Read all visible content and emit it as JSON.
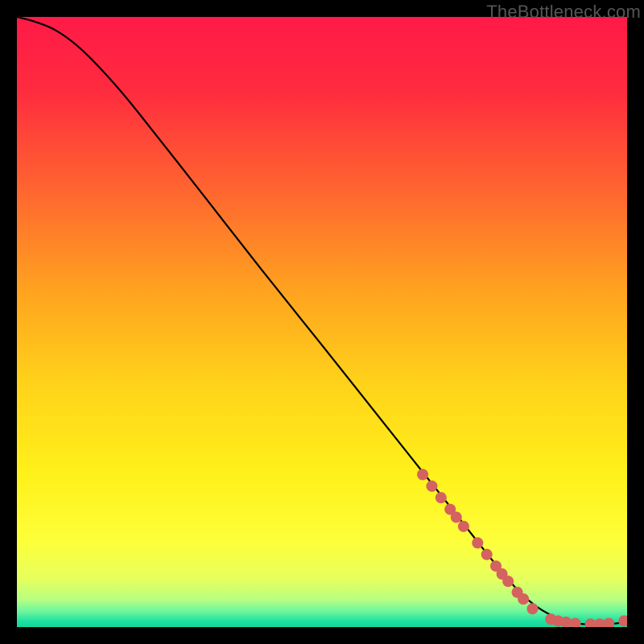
{
  "watermark": "TheBottleneck.com",
  "chart_data": {
    "type": "line",
    "title": "",
    "xlabel": "",
    "ylabel": "",
    "xlim": [
      0,
      100
    ],
    "ylim": [
      0,
      100
    ],
    "background_gradient": {
      "stops": [
        {
          "offset": 0.0,
          "color": "#ff1a47"
        },
        {
          "offset": 0.12,
          "color": "#ff2b3f"
        },
        {
          "offset": 0.3,
          "color": "#ff6b2e"
        },
        {
          "offset": 0.45,
          "color": "#ffa31f"
        },
        {
          "offset": 0.6,
          "color": "#ffd21a"
        },
        {
          "offset": 0.75,
          "color": "#fff11a"
        },
        {
          "offset": 0.86,
          "color": "#fdff3a"
        },
        {
          "offset": 0.92,
          "color": "#e7ff5c"
        },
        {
          "offset": 0.955,
          "color": "#b7ff82"
        },
        {
          "offset": 0.975,
          "color": "#6af59e"
        },
        {
          "offset": 0.99,
          "color": "#1ee2a0"
        },
        {
          "offset": 1.0,
          "color": "#13d79b"
        }
      ]
    },
    "series": [
      {
        "name": "curve",
        "stroke": "#000000",
        "x": [
          0,
          3,
          6,
          9,
          12,
          16,
          20,
          30,
          40,
          50,
          60,
          70,
          80,
          85,
          90,
          95,
          100
        ],
        "y": [
          100,
          99.2,
          98.0,
          96.0,
          93.3,
          89.0,
          84.2,
          71.5,
          58.7,
          46.2,
          33.6,
          21.0,
          8.4,
          3.5,
          1.0,
          0.4,
          0.8
        ]
      }
    ],
    "scatter": [
      {
        "name": "dots",
        "color": "#d4625f",
        "radius": 7,
        "points": [
          {
            "x": 66.5,
            "y": 25.0
          },
          {
            "x": 68.0,
            "y": 23.1
          },
          {
            "x": 69.5,
            "y": 21.2
          },
          {
            "x": 71.0,
            "y": 19.3
          },
          {
            "x": 72.0,
            "y": 18.0
          },
          {
            "x": 73.2,
            "y": 16.5
          },
          {
            "x": 75.5,
            "y": 13.8
          },
          {
            "x": 77.0,
            "y": 11.9
          },
          {
            "x": 78.5,
            "y": 10.0
          },
          {
            "x": 79.5,
            "y": 8.7
          },
          {
            "x": 80.5,
            "y": 7.5
          },
          {
            "x": 82.0,
            "y": 5.7
          },
          {
            "x": 83.0,
            "y": 4.6
          },
          {
            "x": 84.5,
            "y": 3.0
          },
          {
            "x": 87.5,
            "y": 1.3
          },
          {
            "x": 88.7,
            "y": 1.0
          },
          {
            "x": 90.0,
            "y": 0.8
          },
          {
            "x": 91.5,
            "y": 0.6
          },
          {
            "x": 94.0,
            "y": 0.5
          },
          {
            "x": 95.5,
            "y": 0.5
          },
          {
            "x": 97.0,
            "y": 0.6
          },
          {
            "x": 99.5,
            "y": 1.0
          }
        ]
      }
    ]
  }
}
